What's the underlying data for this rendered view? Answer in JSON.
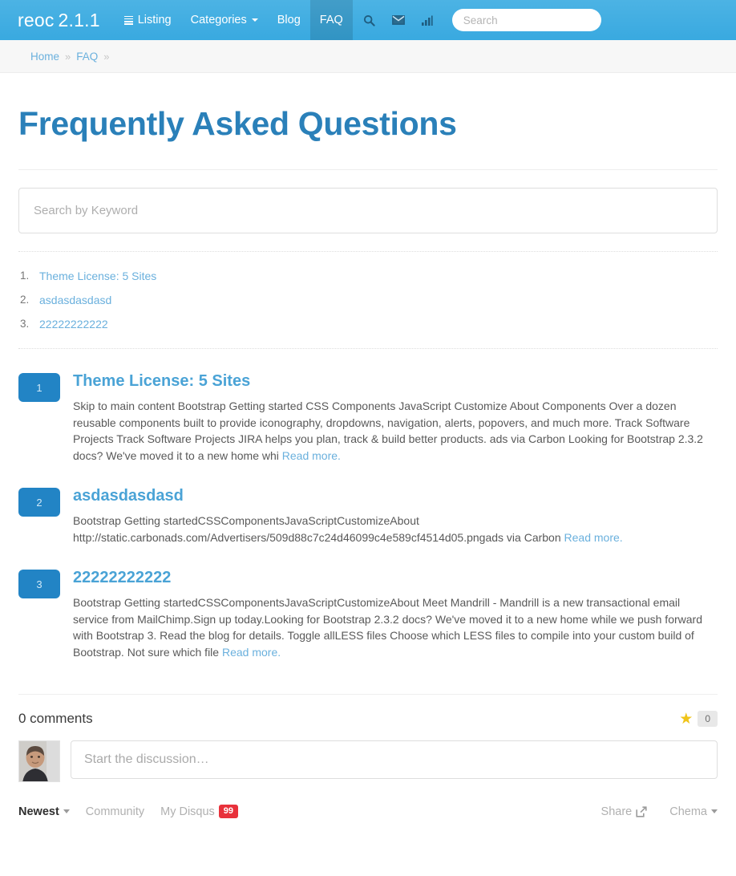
{
  "navbar": {
    "brand_name": "reoc",
    "brand_version": "2.1.1",
    "items": [
      {
        "label": "Listing",
        "icon": "list-icon",
        "active": false,
        "caret": false
      },
      {
        "label": "Categories",
        "icon": "",
        "active": false,
        "caret": true
      },
      {
        "label": "Blog",
        "icon": "",
        "active": false,
        "caret": false
      },
      {
        "label": "FAQ",
        "icon": "",
        "active": true,
        "caret": false
      }
    ],
    "icons": [
      "search-icon",
      "envelope-icon",
      "signal-bars-icon"
    ],
    "search_placeholder": "Search",
    "search_value": "",
    "bg_color": "#45b0e3"
  },
  "breadcrumb": {
    "items": [
      "Home",
      "FAQ"
    ],
    "separator": "»"
  },
  "page": {
    "title": "Frequently Asked Questions",
    "title_color": "#2a80b9",
    "keyword_search_placeholder": "Search by Keyword",
    "keyword_search_value": ""
  },
  "toc": [
    {
      "label": "Theme License: 5 Sites"
    },
    {
      "label": "asdasdasdasd"
    },
    {
      "label": "22222222222"
    }
  ],
  "faqs": [
    {
      "number": "1",
      "title": "Theme License: 5 Sites",
      "text": "Skip to main content Bootstrap Getting started CSS Components JavaScript Customize About Components Over a dozen reusable components built to provide iconography, dropdowns, navigation, alerts, popovers, and much more. Track Software Projects Track Software Projects JIRA helps you plan, track & build better products. ads via Carbon Looking for Bootstrap 2.3.2 docs? We've moved it to a new home whi ",
      "read_more": "Read more."
    },
    {
      "number": "2",
      "title": "asdasdasdasd",
      "text": "Bootstrap Getting startedCSSComponentsJavaScriptCustomizeAbout http://static.carbonads.com/Advertisers/509d88c7c24d46099c4e589cf4514d05.pngads via Carbon ",
      "read_more": "Read more."
    },
    {
      "number": "3",
      "title": "22222222222",
      "text": "Bootstrap Getting startedCSSComponentsJavaScriptCustomizeAbout Meet Mandrill - Mandrill is a new transactional email service from MailChimp.Sign up today.Looking for Bootstrap 2.3.2 docs? We've moved it to a new home while we push forward with Bootstrap 3. Read the blog for details. Toggle allLESS files Choose which LESS files to compile into your custom build of Bootstrap. Not sure which file ",
      "read_more": "Read more."
    }
  ],
  "comments": {
    "count_label": "0 comments",
    "rating_star": "★",
    "rating_count": "0",
    "composer_placeholder": "Start the discussion…",
    "composer_value": "",
    "tabs": [
      {
        "label": "Newest",
        "active": true,
        "caret": true,
        "badge": ""
      },
      {
        "label": "Community",
        "active": false,
        "caret": false,
        "badge": ""
      },
      {
        "label": "My Disqus",
        "active": false,
        "caret": false,
        "badge": "99"
      }
    ],
    "share_label": "Share",
    "user_label": "Chema",
    "badge_color": "#e8313b"
  }
}
